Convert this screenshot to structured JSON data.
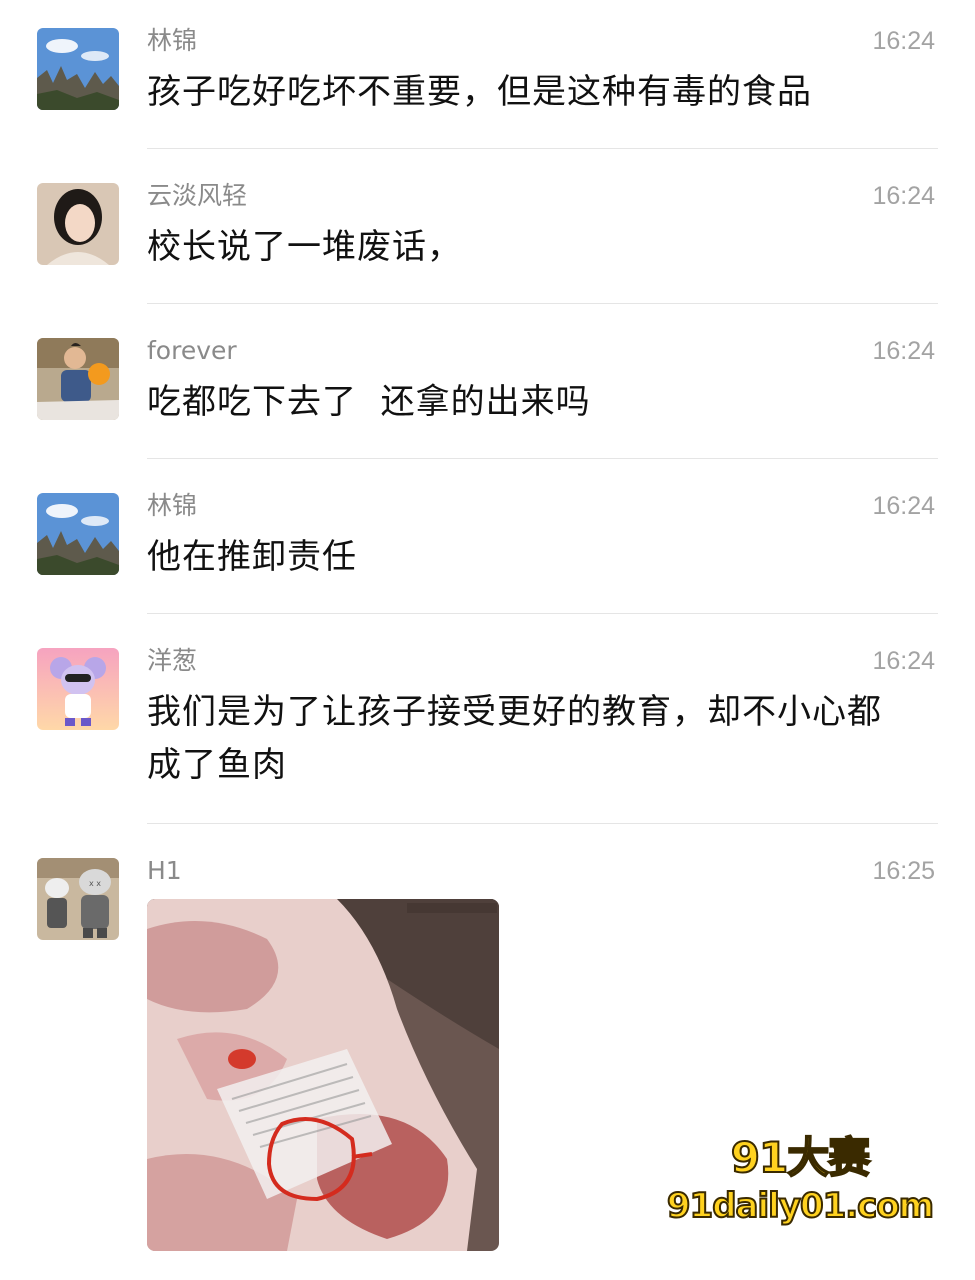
{
  "messages": [
    {
      "name": "林锦",
      "time": "16:24",
      "text": "孩子吃好吃坏不重要，但是这种有毒的食品",
      "avatar_icon": "landscape-avatar-icon"
    },
    {
      "name": "云淡风轻",
      "time": "16:24",
      "text": "校长说了一堆废话，",
      "avatar_icon": "woman-portrait-avatar-icon"
    },
    {
      "name": "forever",
      "time": "16:24",
      "text": "吃都吃下去了  还拿的出来吗",
      "avatar_icon": "child-balloon-avatar-icon"
    },
    {
      "name": "林锦",
      "time": "16:24",
      "text": "他在推卸责任",
      "avatar_icon": "landscape-avatar-icon"
    },
    {
      "name": "洋葱",
      "time": "16:24",
      "text_line1": "我们是为了让孩子接受更好的教育，却不小心都",
      "text_line2": "成了鱼肉",
      "avatar_icon": "cartoon-mouse-avatar-icon"
    },
    {
      "name": "H1",
      "time": "16:25",
      "image": "meat-package-photo",
      "avatar_icon": "toy-figures-avatar-icon"
    }
  ],
  "watermark": {
    "line1": "91大赛",
    "line2": "91daily01.com"
  },
  "colors": {
    "name": "#8a8a8a",
    "time": "#a3a3a3",
    "text": "#111111",
    "divider": "#e5e5e5",
    "watermark": "#ffd21f"
  }
}
